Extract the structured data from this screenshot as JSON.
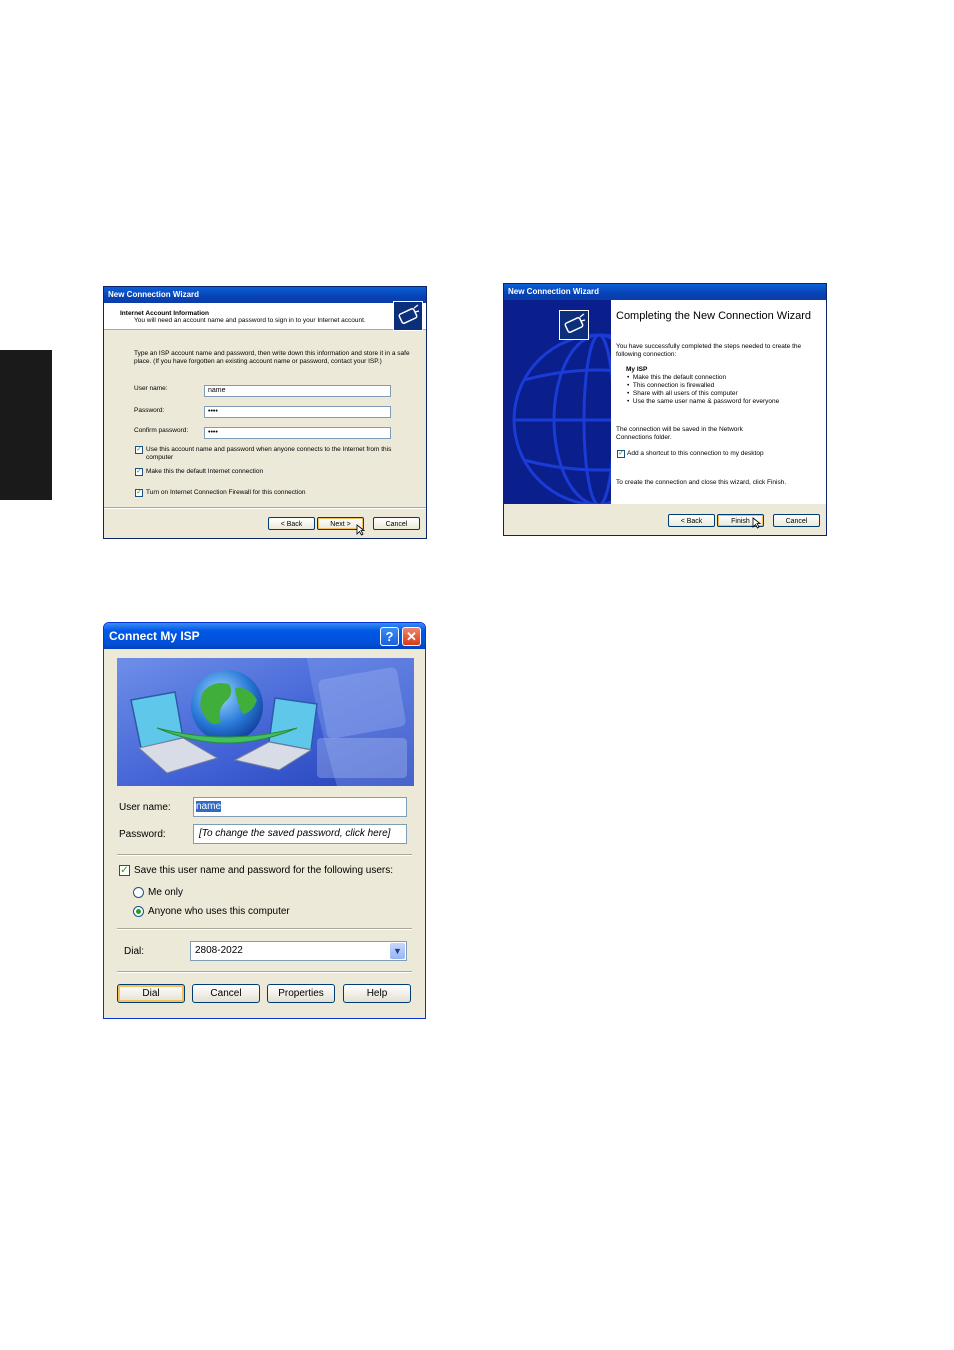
{
  "wizard1": {
    "title": "New Connection Wizard",
    "header_title": "Internet Account Information",
    "header_subtitle": "You will need an account name and password to sign in to your Internet account.",
    "intro": "Type an ISP account name and password, then write down this information and store it in a safe place. (If you have forgotten an existing account name or password, contact your ISP.)",
    "username_label": "User name:",
    "username_value": "name",
    "password_label": "Password:",
    "password_value": "••••",
    "confirm_label": "Confirm password:",
    "confirm_value": "••••",
    "check1": "Use this account  name and password when anyone connects to the Internet from this computer",
    "check2": "Make this the default Internet connection",
    "check3": "Turn on Internet Connection Firewall for this connection",
    "back": "< Back",
    "next": "Next >",
    "cancel": "Cancel"
  },
  "wizard2": {
    "title": "New Connection Wizard",
    "heading": "Completing the New Connection Wizard",
    "intro": "You have successfully completed the steps needed to create the following connection:",
    "connection_name": "My ISP",
    "bullets": [
      "Make this the default connection",
      "This connection is firewalled",
      "Share with all users of this computer",
      "Use the same user name & password for everyone"
    ],
    "saved_note": "The connection will be saved in the Network Connections folder.",
    "shortcut_check": "Add a shortcut to this connection to my desktop",
    "finish_note": "To create the connection and close this wizard, click Finish.",
    "back": "< Back",
    "finish": "Finish",
    "cancel": "Cancel"
  },
  "connect": {
    "title": "Connect My ISP",
    "help_glyph": "?",
    "close_glyph": "✕",
    "username_label": "User name:",
    "username_value": "name",
    "password_label": "Password:",
    "password_value": "[To change the saved password, click here]",
    "save_check": "Save this user name and password for the following users:",
    "radio_me": "Me only",
    "radio_anyone": "Anyone who uses this computer",
    "dial_label": "Dial:",
    "dial_value": "2808-2022",
    "dial_button": "Dial",
    "cancel_button": "Cancel",
    "properties_button": "Properties",
    "help_button": "Help"
  },
  "icons": [
    "wizard-icon",
    "globe-icon",
    "laptop-icon",
    "checkbox-icon",
    "cursor-icon"
  ],
  "colors": {
    "xp_title": "#0a5fd8",
    "dialog_bg": "#ece9d8",
    "banner": "#0a1f8c",
    "check": "#21a121"
  }
}
